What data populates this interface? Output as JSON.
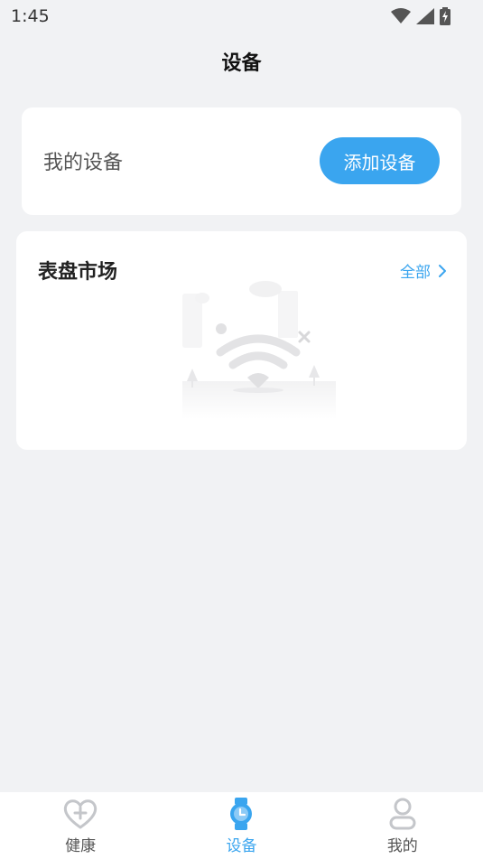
{
  "status_bar": {
    "time": "1:45",
    "icons": [
      "wifi-icon",
      "cell-signal-icon",
      "battery-charging-icon"
    ]
  },
  "header": {
    "title": "设备"
  },
  "my_devices": {
    "label": "我的设备",
    "add_button_label": "添加设备"
  },
  "watchface_market": {
    "title": "表盘市场",
    "view_all_label": "全部",
    "empty_state_icon": "no-network-illustration"
  },
  "bottom_nav": {
    "items": [
      {
        "label": "健康",
        "icon": "heart-plus-icon",
        "active": false
      },
      {
        "label": "设备",
        "icon": "watch-icon",
        "active": true
      },
      {
        "label": "我的",
        "icon": "person-icon",
        "active": false
      }
    ]
  },
  "colors": {
    "accent": "#3aa5ef",
    "background": "#f1f2f4",
    "card": "#ffffff",
    "inactive_icon": "#c4c6ca"
  }
}
